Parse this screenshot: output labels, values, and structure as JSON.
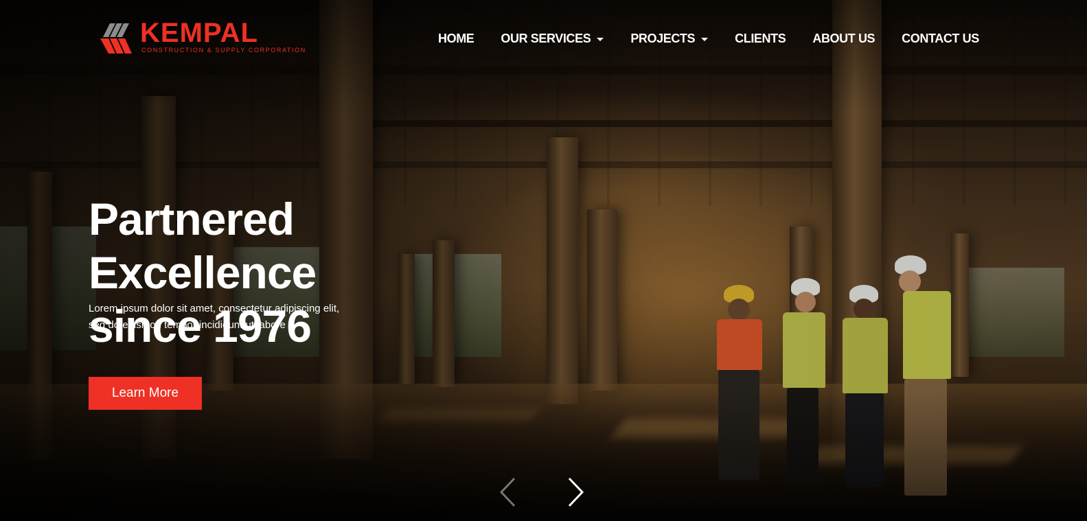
{
  "brand": {
    "name": "KEMPAL",
    "tagline": "CONSTRUCTION & SUPPLY CORPORATION",
    "color": "#ee3124"
  },
  "nav": {
    "items": [
      {
        "label": "HOME",
        "dropdown": false
      },
      {
        "label": "OUR SERVICES",
        "dropdown": true
      },
      {
        "label": "PROJECTS",
        "dropdown": true
      },
      {
        "label": "CLIENTS",
        "dropdown": false
      },
      {
        "label": "ABOUT US",
        "dropdown": false
      },
      {
        "label": "CONTACT US",
        "dropdown": false
      }
    ]
  },
  "hero": {
    "headline_line1": "Partnered Excellence",
    "headline_line2": "since 1976",
    "subtext_line1": "Lorem ipsum dolor sit amet, consectetur adipiscing elit,",
    "subtext_line2": "sed do eiusmod tempor incididunt ut labore",
    "cta_label": "Learn More",
    "cta_color": "#ee3124"
  },
  "carousel": {
    "prev_icon": "chevron-left-icon",
    "next_icon": "chevron-right-icon"
  }
}
